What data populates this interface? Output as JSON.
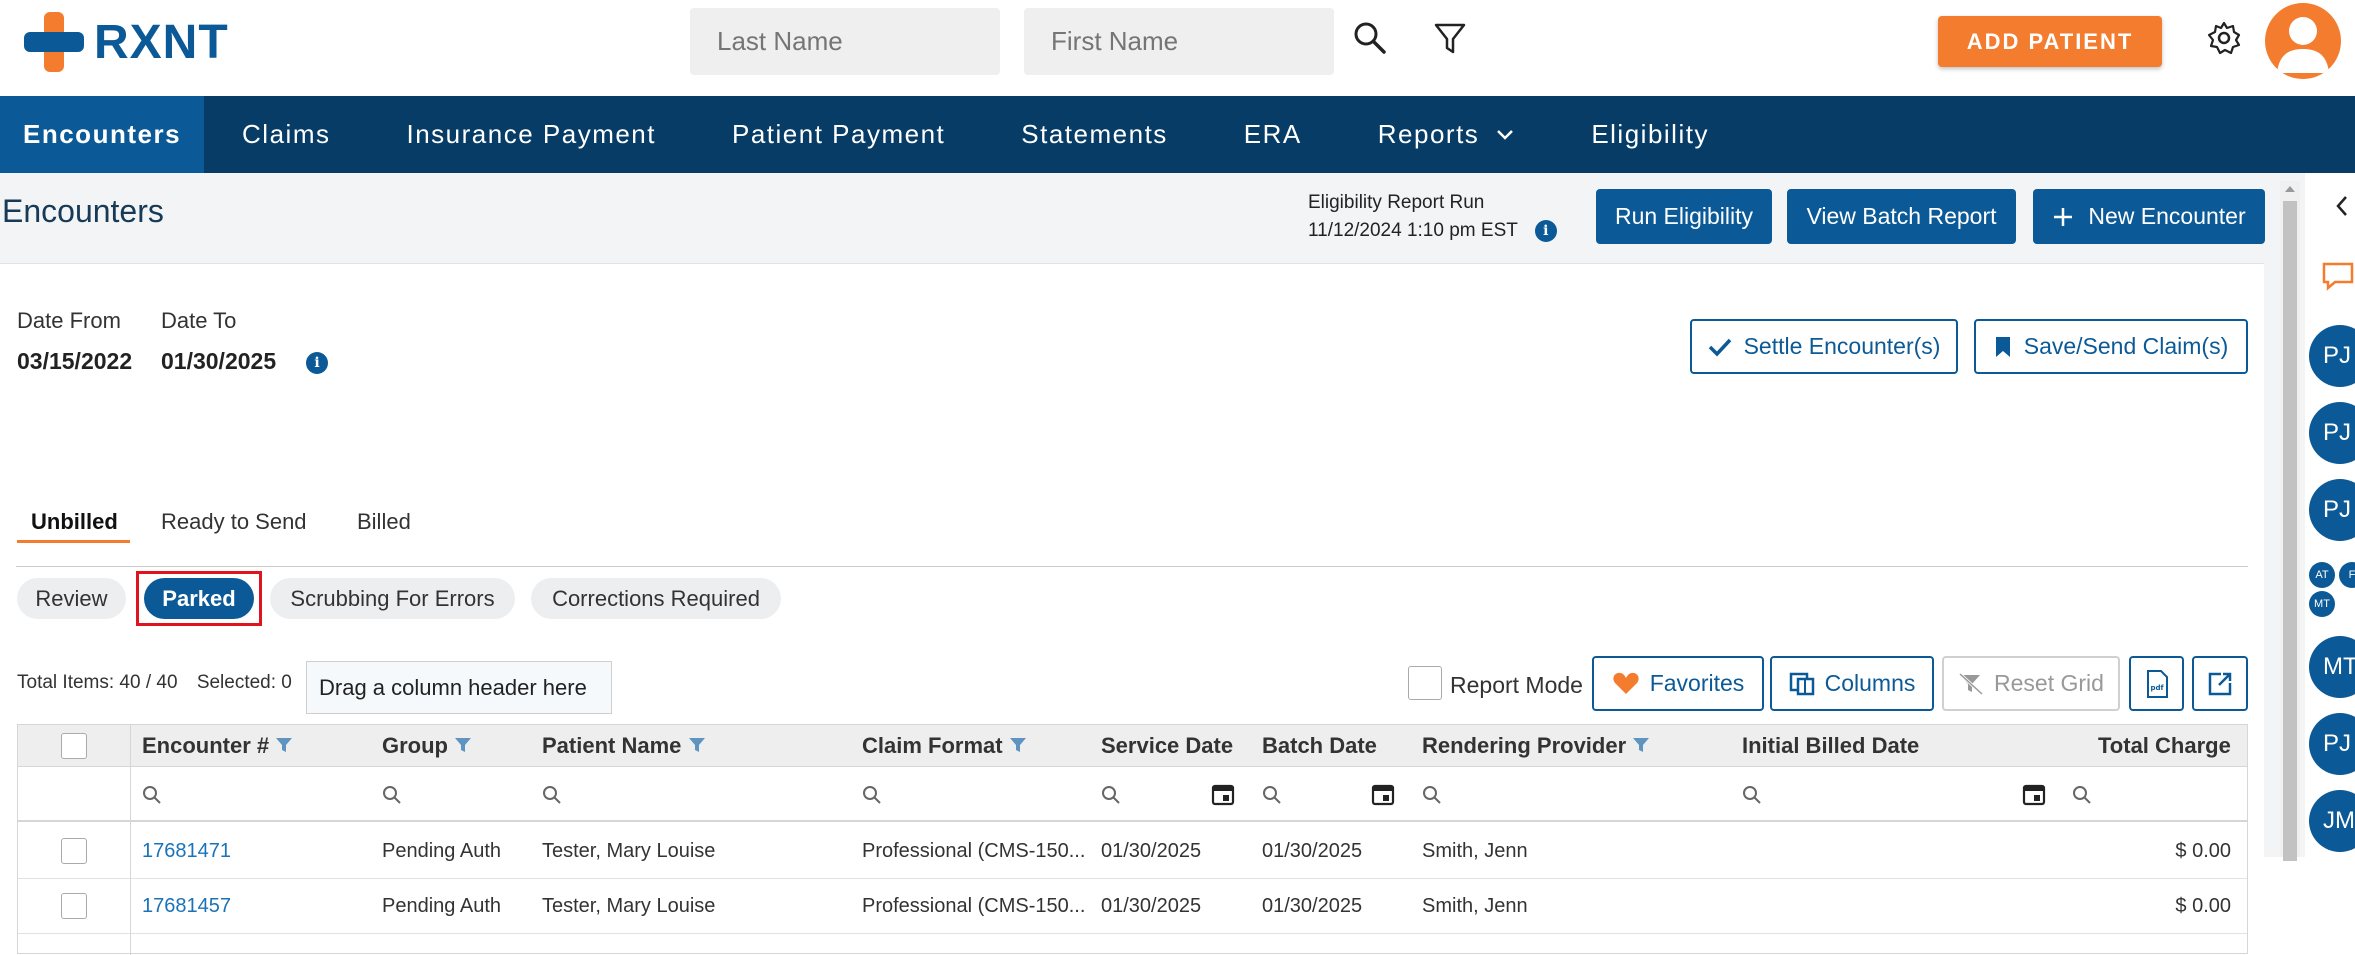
{
  "brand": {
    "name": "RXNT"
  },
  "search": {
    "last_name_placeholder": "Last Name",
    "first_name_placeholder": "First Name"
  },
  "header": {
    "add_patient_label": "ADD PATIENT"
  },
  "nav": {
    "items": [
      {
        "label": "Encounters"
      },
      {
        "label": "Claims"
      },
      {
        "label": "Insurance Payment"
      },
      {
        "label": "Patient Payment"
      },
      {
        "label": "Statements"
      },
      {
        "label": "ERA"
      },
      {
        "label": "Reports"
      },
      {
        "label": "Eligibility"
      }
    ]
  },
  "page": {
    "title": "Encounters",
    "eligibility_line1": "Eligibility Report Run",
    "eligibility_line2": "11/12/2024 1:10 pm EST",
    "run_eligibility": "Run Eligibility",
    "view_batch_report": "View Batch Report",
    "new_encounter": "New Encounter"
  },
  "filters": {
    "date_from_label": "Date From",
    "date_from_value": "03/15/2022",
    "date_to_label": "Date To",
    "date_to_value": "01/30/2025",
    "settle_label": "Settle Encounter(s)",
    "save_send_label": "Save/Send Claim(s)"
  },
  "tabs": [
    {
      "label": "Unbilled"
    },
    {
      "label": "Ready to Send"
    },
    {
      "label": "Billed"
    }
  ],
  "subtabs": [
    {
      "label": "Review"
    },
    {
      "label": "Parked"
    },
    {
      "label": "Scrubbing For Errors"
    },
    {
      "label": "Corrections Required"
    }
  ],
  "toolbar": {
    "total_items": "Total Items: 40 / 40",
    "selected": "Selected: 0",
    "drag_hint": "Drag a column header here",
    "report_mode": "Report Mode",
    "favorites": "Favorites",
    "columns": "Columns",
    "reset_grid": "Reset Grid",
    "pdf_icon_text": "pdf"
  },
  "grid": {
    "columns": [
      {
        "label": "Encounter #"
      },
      {
        "label": "Group"
      },
      {
        "label": "Patient Name"
      },
      {
        "label": "Claim Format"
      },
      {
        "label": "Service Date"
      },
      {
        "label": "Batch Date"
      },
      {
        "label": "Rendering Provider"
      },
      {
        "label": "Initial Billed Date"
      },
      {
        "label": "Total Charge"
      }
    ],
    "rows": [
      {
        "encounter": "17681471",
        "group": "Pending Auth",
        "patient": "Tester, Mary Louise",
        "format": "Professional (CMS-150...",
        "service_date": "01/30/2025",
        "batch_date": "01/30/2025",
        "provider": "Smith, Jenn",
        "initial_billed": "",
        "total": "$ 0.00"
      },
      {
        "encounter": "17681457",
        "group": "Pending Auth",
        "patient": "Tester, Mary Louise",
        "format": "Professional (CMS-150...",
        "service_date": "01/30/2025",
        "batch_date": "01/30/2025",
        "provider": "Smith, Jenn",
        "initial_billed": "",
        "total": "$ 0.00"
      }
    ]
  },
  "side_panel": {
    "avatars": [
      {
        "initials": "PJ"
      },
      {
        "initials": "PJ"
      },
      {
        "initials": "PJ"
      },
      {
        "initials": "MT"
      },
      {
        "initials": "PJ"
      },
      {
        "initials": "JM"
      }
    ],
    "mini": [
      {
        "initials": "AT"
      },
      {
        "initials": "F"
      },
      {
        "initials": "MT"
      }
    ]
  },
  "colors": {
    "primary": "#0b5a97",
    "nav_bg": "#063c66",
    "accent": "#f47c2e",
    "highlight": "#e0141e"
  }
}
